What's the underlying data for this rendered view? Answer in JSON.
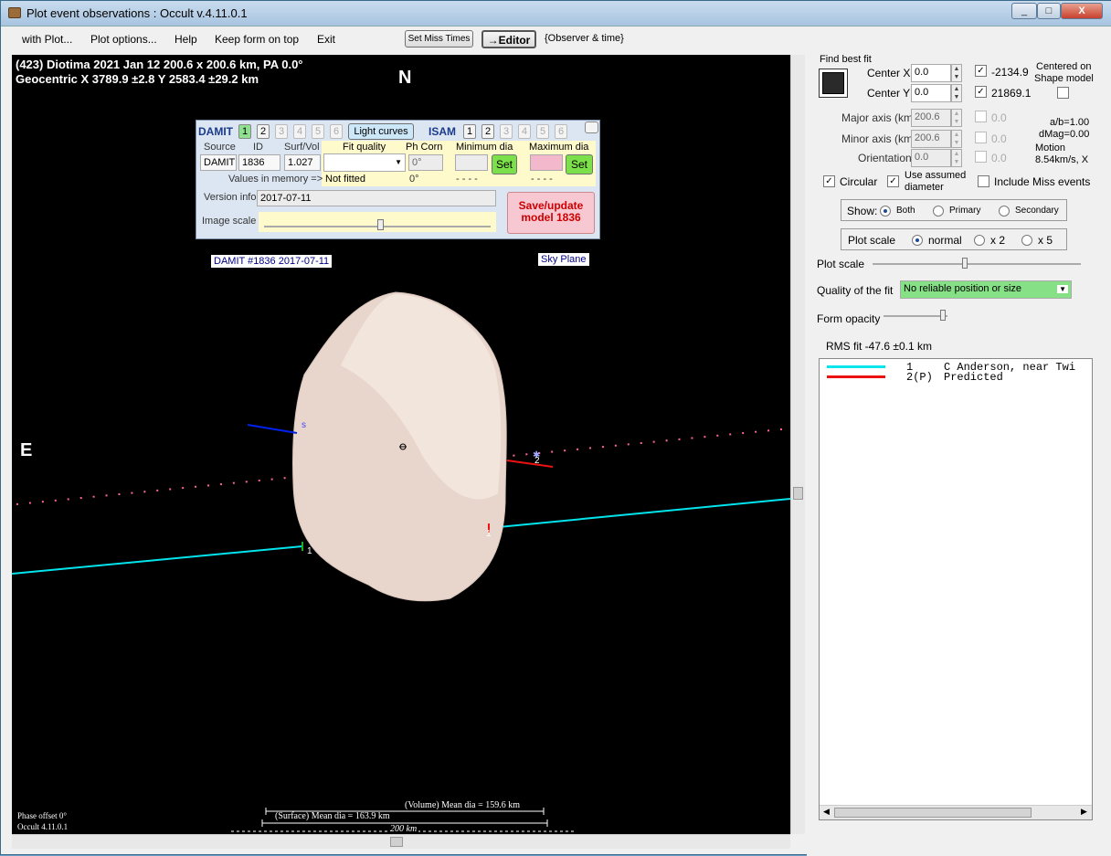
{
  "window": {
    "title": "Plot event observations : Occult v.4.11.0.1",
    "min": "_",
    "max": "□",
    "close": "X"
  },
  "menu": {
    "items": [
      "with Plot...",
      "Plot options...",
      "Help",
      "Keep form on top",
      "Exit"
    ],
    "set_miss_times": "Set Miss Times",
    "editor": "→Editor",
    "observer_time": "{Observer & time}"
  },
  "plot": {
    "header_line1": "(423) Diotima  2021 Jan 12  200.6 x 200.6 km, PA 0.0°",
    "header_line2": "Geocentric  X  3789.9 ±2.8  Y 2583.4 ±29.2 km",
    "north": "N",
    "east": "E",
    "model_label": "DAMIT #1836 2017-07-11",
    "sky_plane": "Sky Plane",
    "chord_s": "s",
    "chord_1a": "1",
    "chord_1b": "1",
    "chord_2": "2",
    "volume_dia": "(Volume) Mean dia = 159.6 km",
    "surface_dia": "(Surface) Mean dia = 163.9 km",
    "scale_200": "200 km",
    "phase_offset": "Phase offset 0°",
    "version": "Occult 4.11.0.1"
  },
  "damit": {
    "title": "DAMIT",
    "isam": "ISAM",
    "nums": [
      "1",
      "2",
      "3",
      "4",
      "5",
      "6"
    ],
    "light_curves": "Light curves",
    "source_h": "Source",
    "id_h": "ID",
    "surf_h": "Surf/Vol",
    "source": "DAMIT",
    "id": "1836",
    "surf": "1.027",
    "fit_quality_h": "Fit quality",
    "ph_corn_h": "Ph Corn",
    "min_dia_h": "Minimum dia",
    "max_dia_h": "Maximum dia",
    "ph_corn": "0°",
    "set": "Set",
    "values_mem": "Values in memory =>",
    "not_fitted": "Not fitted",
    "ph_mem": "0°",
    "min_mem": "- - - -",
    "max_mem": "- - - -",
    "version_info_l": "Version info",
    "version_info": "2017-07-11",
    "image_scale_l": "Image scale",
    "save_update": "Save/update",
    "save_model": "model 1836"
  },
  "right": {
    "find_best_fit": "Find best fit",
    "center_x_l": "Center X",
    "center_x": "0.0",
    "center_y_l": "Center Y",
    "center_y": "0.0",
    "cx_val": "-2134.9",
    "cy_val": "21869.1",
    "centered_on": "Centered on",
    "shape_model": "Shape model",
    "major_l": "Major axis (km)",
    "major": "200.6",
    "major_v": "0.0",
    "minor_l": "Minor axis (km)",
    "minor": "200.6",
    "minor_v": "0.0",
    "orient_l": "Orientation",
    "orient": "0.0",
    "orient_v": "0.0",
    "ab": "a/b=1.00",
    "dmag": "dMag=0.00",
    "motion": "Motion",
    "motion_v": "8.54km/s, X",
    "circular": "Circular",
    "use_assumed": "Use assumed",
    "diameter": "diameter",
    "include_miss": "Include Miss events",
    "show_l": "Show:",
    "both": "Both",
    "primary": "Primary",
    "secondary": "Secondary",
    "plot_scale_l": "Plot scale",
    "normal": "normal",
    "x2": "x 2",
    "x5": "x 5",
    "plot_scale_slider": "Plot scale",
    "quality_l": "Quality of the fit",
    "quality": "No reliable position or size",
    "form_opacity": "Form opacity",
    "rms": "RMS fit -47.6 ±0.1 km",
    "legend": [
      {
        "num": "1",
        "name": "C Anderson, near Twi",
        "color": "#00e5ee"
      },
      {
        "num": "2(P)",
        "name": "Predicted",
        "color": "#ee1111"
      }
    ]
  }
}
